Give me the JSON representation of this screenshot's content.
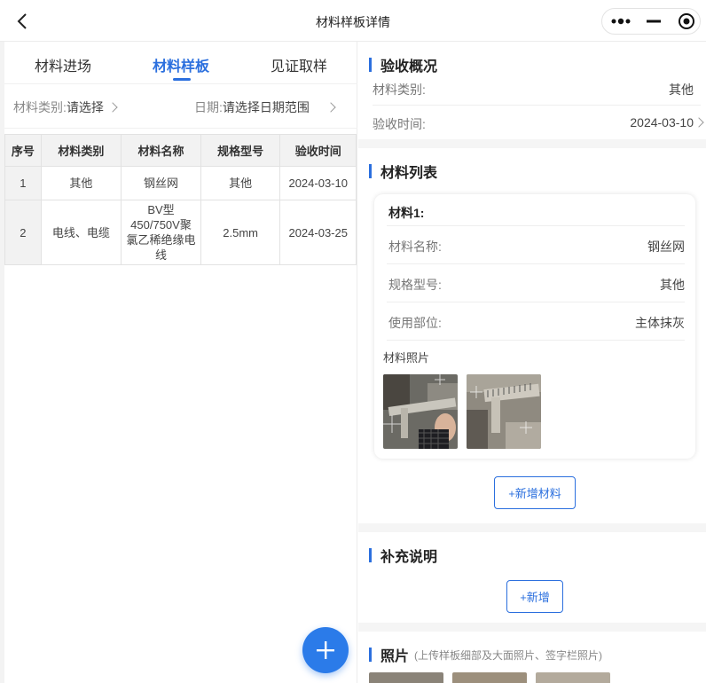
{
  "header": {
    "title": "材料样板详情"
  },
  "tabs": [
    {
      "label": "材料进场"
    },
    {
      "label": "材料样板"
    },
    {
      "label": "见证取样"
    }
  ],
  "filters": {
    "category_label": "材料类别:",
    "category_value": "请选择",
    "date_label": "日期:",
    "date_value": "请选择日期范围"
  },
  "table": {
    "headers": [
      "序号",
      "材料类别",
      "材料名称",
      "规格型号",
      "验收时间"
    ],
    "rows": [
      [
        "1",
        "其他",
        "钢丝网",
        "其他",
        "2024-03-10"
      ],
      [
        "2",
        "电线、电缆",
        "BV型450/750V聚氯乙稀绝缘电线",
        "2.5mm",
        "2024-03-25"
      ]
    ]
  },
  "overview": {
    "title": "验收概况",
    "category_key": "材料类别:",
    "category_value": "其他",
    "time_key": "验收时间:",
    "time_value": "2024-03-10"
  },
  "material_list": {
    "title": "材料列表",
    "card_title": "材料1:",
    "name_key": "材料名称:",
    "name_value": "钢丝网",
    "spec_key": "规格型号:",
    "spec_value": "其他",
    "location_key": "使用部位:",
    "location_value": "主体抹灰",
    "photo_label": "材料照片",
    "add_button": "+新增材料"
  },
  "supplement": {
    "title": "补充说明",
    "add_button": "+新增"
  },
  "photos": {
    "title": "照片",
    "note": "(上传样板细部及大面照片、签字栏照片)"
  },
  "colors": {
    "accent": "#2b6fde",
    "fab": "#2b7be9"
  }
}
